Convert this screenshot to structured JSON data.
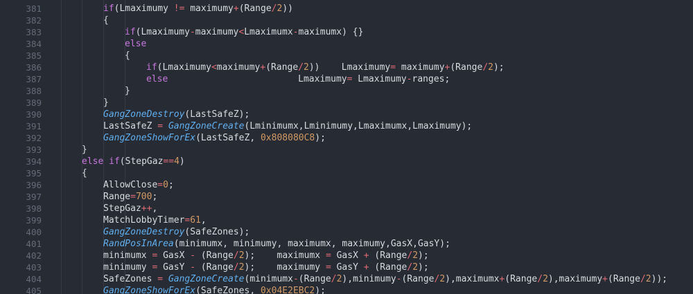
{
  "colors": {
    "background": "#272b33",
    "line_number": "#636b78",
    "plain": "#d7dae0",
    "keyword": "#c678dd",
    "operator": "#e06c75",
    "number": "#d19a66",
    "function": "#61afef"
  },
  "lines": [
    {
      "number": "381",
      "indent": 2,
      "tokens": [
        {
          "t": "kw",
          "v": "if"
        },
        {
          "t": "pl",
          "v": "(Lmaximumy "
        },
        {
          "t": "op",
          "v": "!="
        },
        {
          "t": "pl",
          "v": " maximumy"
        },
        {
          "t": "op",
          "v": "+"
        },
        {
          "t": "pl",
          "v": "(Range"
        },
        {
          "t": "op",
          "v": "/"
        },
        {
          "t": "num",
          "v": "2"
        },
        {
          "t": "pl",
          "v": "))"
        }
      ]
    },
    {
      "number": "382",
      "indent": 2,
      "tokens": [
        {
          "t": "pl",
          "v": "{"
        }
      ]
    },
    {
      "number": "383",
      "indent": 3,
      "tokens": [
        {
          "t": "kw",
          "v": "if"
        },
        {
          "t": "pl",
          "v": "(Lmaximumy"
        },
        {
          "t": "op",
          "v": "-"
        },
        {
          "t": "pl",
          "v": "maximumy"
        },
        {
          "t": "op",
          "v": "<"
        },
        {
          "t": "pl",
          "v": "Lmaximumx"
        },
        {
          "t": "op",
          "v": "-"
        },
        {
          "t": "pl",
          "v": "maximumx) {}"
        }
      ]
    },
    {
      "number": "384",
      "indent": 3,
      "tokens": [
        {
          "t": "kw",
          "v": "else"
        }
      ]
    },
    {
      "number": "385",
      "indent": 3,
      "tokens": [
        {
          "t": "pl",
          "v": "{"
        }
      ]
    },
    {
      "number": "386",
      "indent": 4,
      "tokens": [
        {
          "t": "kw",
          "v": "if"
        },
        {
          "t": "pl",
          "v": "(Lmaximumy"
        },
        {
          "t": "op",
          "v": "<"
        },
        {
          "t": "pl",
          "v": "maximumy"
        },
        {
          "t": "op",
          "v": "+"
        },
        {
          "t": "pl",
          "v": "(Range"
        },
        {
          "t": "op",
          "v": "/"
        },
        {
          "t": "num",
          "v": "2"
        },
        {
          "t": "pl",
          "v": "))    Lmaximumy"
        },
        {
          "t": "op",
          "v": "="
        },
        {
          "t": "pl",
          "v": " maximumy"
        },
        {
          "t": "op",
          "v": "+"
        },
        {
          "t": "pl",
          "v": "(Range"
        },
        {
          "t": "op",
          "v": "/"
        },
        {
          "t": "num",
          "v": "2"
        },
        {
          "t": "pl",
          "v": ");"
        }
      ]
    },
    {
      "number": "387",
      "indent": 4,
      "tokens": [
        {
          "t": "kw",
          "v": "else"
        },
        {
          "t": "pl",
          "v": "                        Lmaximumy"
        },
        {
          "t": "op",
          "v": "="
        },
        {
          "t": "pl",
          "v": " Lmaximumy"
        },
        {
          "t": "op",
          "v": "-"
        },
        {
          "t": "pl",
          "v": "ranges;"
        }
      ]
    },
    {
      "number": "388",
      "indent": 3,
      "tokens": [
        {
          "t": "pl",
          "v": "}"
        }
      ]
    },
    {
      "number": "389",
      "indent": 2,
      "tokens": [
        {
          "t": "pl",
          "v": "}"
        }
      ]
    },
    {
      "number": "390",
      "indent": 2,
      "tokens": [
        {
          "t": "fn",
          "v": "GangZoneDestroy"
        },
        {
          "t": "pl",
          "v": "(LastSafeZ);"
        }
      ]
    },
    {
      "number": "391",
      "indent": 2,
      "tokens": [
        {
          "t": "pl",
          "v": "LastSafeZ "
        },
        {
          "t": "op",
          "v": "="
        },
        {
          "t": "pl",
          "v": " "
        },
        {
          "t": "fn",
          "v": "GangZoneCreate"
        },
        {
          "t": "pl",
          "v": "(Lminimumx,Lminimumy,Lmaximumx,Lmaximumy);"
        }
      ]
    },
    {
      "number": "392",
      "indent": 2,
      "tokens": [
        {
          "t": "fn",
          "v": "GangZoneShowForEx"
        },
        {
          "t": "pl",
          "v": "(LastSafeZ, "
        },
        {
          "t": "num",
          "v": "0x808080C8"
        },
        {
          "t": "pl",
          "v": ");"
        }
      ]
    },
    {
      "number": "393",
      "indent": 1,
      "tokens": [
        {
          "t": "pl",
          "v": "}"
        }
      ]
    },
    {
      "number": "394",
      "indent": 1,
      "tokens": [
        {
          "t": "kw",
          "v": "else"
        },
        {
          "t": "pl",
          "v": " "
        },
        {
          "t": "kw",
          "v": "if"
        },
        {
          "t": "pl",
          "v": "(StepGaz"
        },
        {
          "t": "op",
          "v": "=="
        },
        {
          "t": "num",
          "v": "4"
        },
        {
          "t": "pl",
          "v": ")"
        }
      ]
    },
    {
      "number": "395",
      "indent": 1,
      "tokens": [
        {
          "t": "pl",
          "v": "{"
        }
      ]
    },
    {
      "number": "396",
      "indent": 2,
      "tokens": [
        {
          "t": "pl",
          "v": "AllowClose"
        },
        {
          "t": "op",
          "v": "="
        },
        {
          "t": "num",
          "v": "0"
        },
        {
          "t": "pl",
          "v": ";"
        }
      ]
    },
    {
      "number": "397",
      "indent": 2,
      "tokens": [
        {
          "t": "pl",
          "v": "Range"
        },
        {
          "t": "op",
          "v": "="
        },
        {
          "t": "num",
          "v": "700"
        },
        {
          "t": "pl",
          "v": ";"
        }
      ]
    },
    {
      "number": "398",
      "indent": 2,
      "tokens": [
        {
          "t": "pl",
          "v": "StepGaz"
        },
        {
          "t": "op",
          "v": "++"
        },
        {
          "t": "pl",
          "v": ","
        }
      ]
    },
    {
      "number": "399",
      "indent": 2,
      "tokens": [
        {
          "t": "pl",
          "v": "MatchLobbyTimer"
        },
        {
          "t": "op",
          "v": "="
        },
        {
          "t": "num",
          "v": "61"
        },
        {
          "t": "pl",
          "v": ","
        }
      ]
    },
    {
      "number": "400",
      "indent": 2,
      "tokens": [
        {
          "t": "fn",
          "v": "GangZoneDestroy"
        },
        {
          "t": "pl",
          "v": "(SafeZones);"
        }
      ]
    },
    {
      "number": "401",
      "indent": 2,
      "tokens": [
        {
          "t": "fn",
          "v": "RandPosInArea"
        },
        {
          "t": "pl",
          "v": "(minimumx, minimumy, maximumx, maximumy,GasX,GasY);"
        }
      ]
    },
    {
      "number": "402",
      "indent": 2,
      "tokens": [
        {
          "t": "pl",
          "v": "minimumx "
        },
        {
          "t": "op",
          "v": "="
        },
        {
          "t": "pl",
          "v": " GasX "
        },
        {
          "t": "op",
          "v": "-"
        },
        {
          "t": "pl",
          "v": " (Range"
        },
        {
          "t": "op",
          "v": "/"
        },
        {
          "t": "num",
          "v": "2"
        },
        {
          "t": "pl",
          "v": ");    maximumx "
        },
        {
          "t": "op",
          "v": "="
        },
        {
          "t": "pl",
          "v": " GasX "
        },
        {
          "t": "op",
          "v": "+"
        },
        {
          "t": "pl",
          "v": " (Range"
        },
        {
          "t": "op",
          "v": "/"
        },
        {
          "t": "num",
          "v": "2"
        },
        {
          "t": "pl",
          "v": ");"
        }
      ]
    },
    {
      "number": "403",
      "indent": 2,
      "tokens": [
        {
          "t": "pl",
          "v": "minimumy "
        },
        {
          "t": "op",
          "v": "="
        },
        {
          "t": "pl",
          "v": " GasY "
        },
        {
          "t": "op",
          "v": "-"
        },
        {
          "t": "pl",
          "v": " (Range"
        },
        {
          "t": "op",
          "v": "/"
        },
        {
          "t": "num",
          "v": "2"
        },
        {
          "t": "pl",
          "v": ");    maximumy "
        },
        {
          "t": "op",
          "v": "="
        },
        {
          "t": "pl",
          "v": " GasY "
        },
        {
          "t": "op",
          "v": "+"
        },
        {
          "t": "pl",
          "v": " (Range"
        },
        {
          "t": "op",
          "v": "/"
        },
        {
          "t": "num",
          "v": "2"
        },
        {
          "t": "pl",
          "v": ");"
        }
      ]
    },
    {
      "number": "404",
      "indent": 2,
      "tokens": [
        {
          "t": "pl",
          "v": "SafeZones "
        },
        {
          "t": "op",
          "v": "="
        },
        {
          "t": "pl",
          "v": " "
        },
        {
          "t": "fn",
          "v": "GangZoneCreate"
        },
        {
          "t": "pl",
          "v": "(minimumx"
        },
        {
          "t": "op",
          "v": "-"
        },
        {
          "t": "pl",
          "v": "(Range"
        },
        {
          "t": "op",
          "v": "/"
        },
        {
          "t": "num",
          "v": "2"
        },
        {
          "t": "pl",
          "v": "),minimumy"
        },
        {
          "t": "op",
          "v": "-"
        },
        {
          "t": "pl",
          "v": "(Range"
        },
        {
          "t": "op",
          "v": "/"
        },
        {
          "t": "num",
          "v": "2"
        },
        {
          "t": "pl",
          "v": "),maximumx"
        },
        {
          "t": "op",
          "v": "+"
        },
        {
          "t": "pl",
          "v": "(Range"
        },
        {
          "t": "op",
          "v": "/"
        },
        {
          "t": "num",
          "v": "2"
        },
        {
          "t": "pl",
          "v": "),maximumy"
        },
        {
          "t": "op",
          "v": "+"
        },
        {
          "t": "pl",
          "v": "(Range"
        },
        {
          "t": "op",
          "v": "/"
        },
        {
          "t": "num",
          "v": "2"
        },
        {
          "t": "pl",
          "v": "));"
        }
      ]
    },
    {
      "number": "405",
      "indent": 2,
      "tokens": [
        {
          "t": "fn",
          "v": "GangZoneShowForEx"
        },
        {
          "t": "pl",
          "v": "(SafeZones, "
        },
        {
          "t": "num",
          "v": "0x04E2EBC2"
        },
        {
          "t": "pl",
          "v": ");"
        }
      ]
    }
  ]
}
